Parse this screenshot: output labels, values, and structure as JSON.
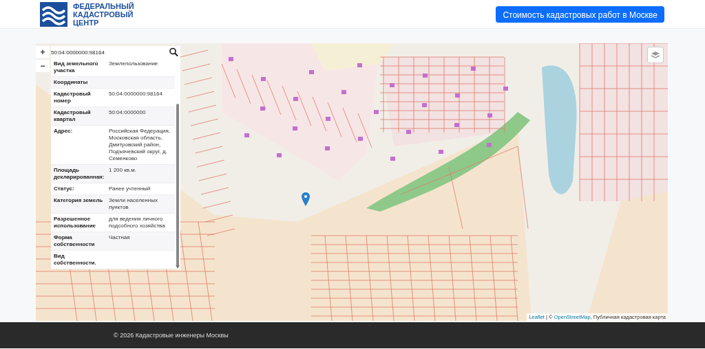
{
  "header": {
    "logo_lines": [
      "ФЕДЕРАЛЬНЫЙ",
      "КАДАСТРОВЫЙ",
      "ЦЕНТР"
    ],
    "cta_button": "Стоимость кадастровых работ в Москве"
  },
  "map": {
    "zoom_in": "+",
    "zoom_out": "−",
    "search": {
      "value": "50:04:0000000:98164"
    },
    "info_rows": [
      {
        "kind": "pair",
        "label": "Вид земельного участка",
        "value": "Землепользование"
      },
      {
        "kind": "heading",
        "label": "Координаты"
      },
      {
        "kind": "pair",
        "label": "Кадастровый номер",
        "value": "50:04:0000000:98164"
      },
      {
        "kind": "pair",
        "label": "Кадастровый квартал",
        "value": "50:04:0000000"
      },
      {
        "kind": "pair",
        "label": "Адрес:",
        "value": "Российская Федерация, Московская область, Дмитровский район, Подъячевский округ, д. Семенково"
      },
      {
        "kind": "pair",
        "label": "Площадь декларированная:",
        "value": "1 200 кв.м."
      },
      {
        "kind": "pair",
        "label": "Статус:",
        "value": "Ранее учтенный"
      },
      {
        "kind": "pair",
        "label": "Категория земель",
        "value": "Земли населенных пунктов"
      },
      {
        "kind": "pair",
        "label": "Разрешенное использование",
        "value": "для ведения личного подсобного хозяйства"
      },
      {
        "kind": "pair",
        "label": "Форма собственности",
        "value": "Частная"
      },
      {
        "kind": "pair",
        "label": "Вид собственности."
      }
    ],
    "attribution": {
      "leaflet_link": "Leaflet",
      "separator": "| ©",
      "osm_link": "OpenStreetMap",
      "suffix": ", Публичная кадастровая карта"
    }
  },
  "footer": {
    "text": "© 2026 Кадастровые инженеры Москвы"
  }
}
